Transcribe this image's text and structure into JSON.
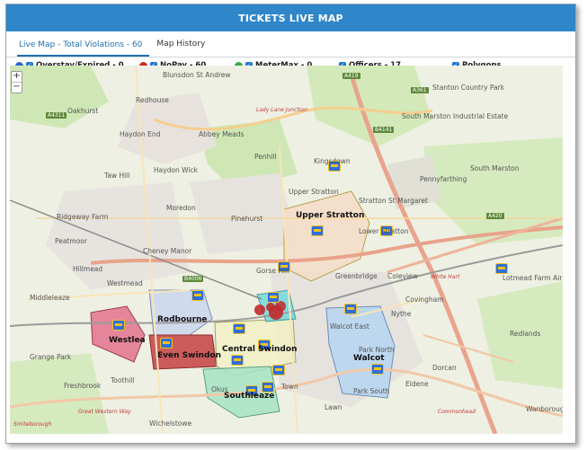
{
  "header": {
    "title": "TICKETS LIVE MAP"
  },
  "tabs": [
    {
      "label": "Live Map - Total Violations - 60",
      "active": true
    },
    {
      "label": "Map History",
      "active": false
    }
  ],
  "legend": {
    "overstay": {
      "label": "Overstay/Expired - 0",
      "color": "#2a66d6",
      "checked": true
    },
    "nopay": {
      "label": "NoPay - 60",
      "color": "#cc2a2a",
      "checked": true
    },
    "metermax": {
      "label": "MeterMax - 0",
      "color": "#3aa84a",
      "checked": true
    },
    "officers": {
      "label": "Officers - 17",
      "checked": true
    },
    "polygons": {
      "label": "Polygons",
      "checked": true
    }
  },
  "map": {
    "zoom_in": "+",
    "zoom_out": "−",
    "place_labels": [
      "Blunsdon St Andrew",
      "Redhouse",
      "Oakhurst",
      "Haydon End",
      "Abbey Meads",
      "Haydon Wick",
      "Penhill",
      "Taw Hill",
      "Moredon",
      "Pinehurst",
      "Ridgeway Farm",
      "Peatmoor",
      "Cheney Manor",
      "Hillmead",
      "Middleleaze",
      "Westmead",
      "Grange Park",
      "Freshbrook",
      "Toothill",
      "Wichelstowe",
      "Kingsdown",
      "Upper Stratton",
      "Stratton St Margaret",
      "Lower Stratton",
      "Gorse Hill",
      "Greenbridge",
      "Coleview",
      "Covingham",
      "Nythe",
      "Walcot East",
      "Park North",
      "Dorcan",
      "Eldene",
      "Park South",
      "Lawn",
      "Town",
      "Okus",
      "Redlands",
      "Wanborough",
      "South Marston",
      "Stanton Country Park",
      "South Marston Industrial Estate",
      "Pennyfarthing",
      "Lotmead Farm Airstrip"
    ],
    "road_labels": [
      "A419",
      "B4006",
      "B4141",
      "A361",
      "A420",
      "A4311"
    ],
    "red_labels": [
      "Lady Lane Junction",
      "White Hart",
      "Commonhead",
      "Great Western Way",
      "Smiteborough"
    ],
    "zone_labels": [
      "Upper Stratton",
      "Rodbourne",
      "Westlea",
      "Even Swindon",
      "Central Swindon",
      "Walcot",
      "Southleaze"
    ]
  }
}
